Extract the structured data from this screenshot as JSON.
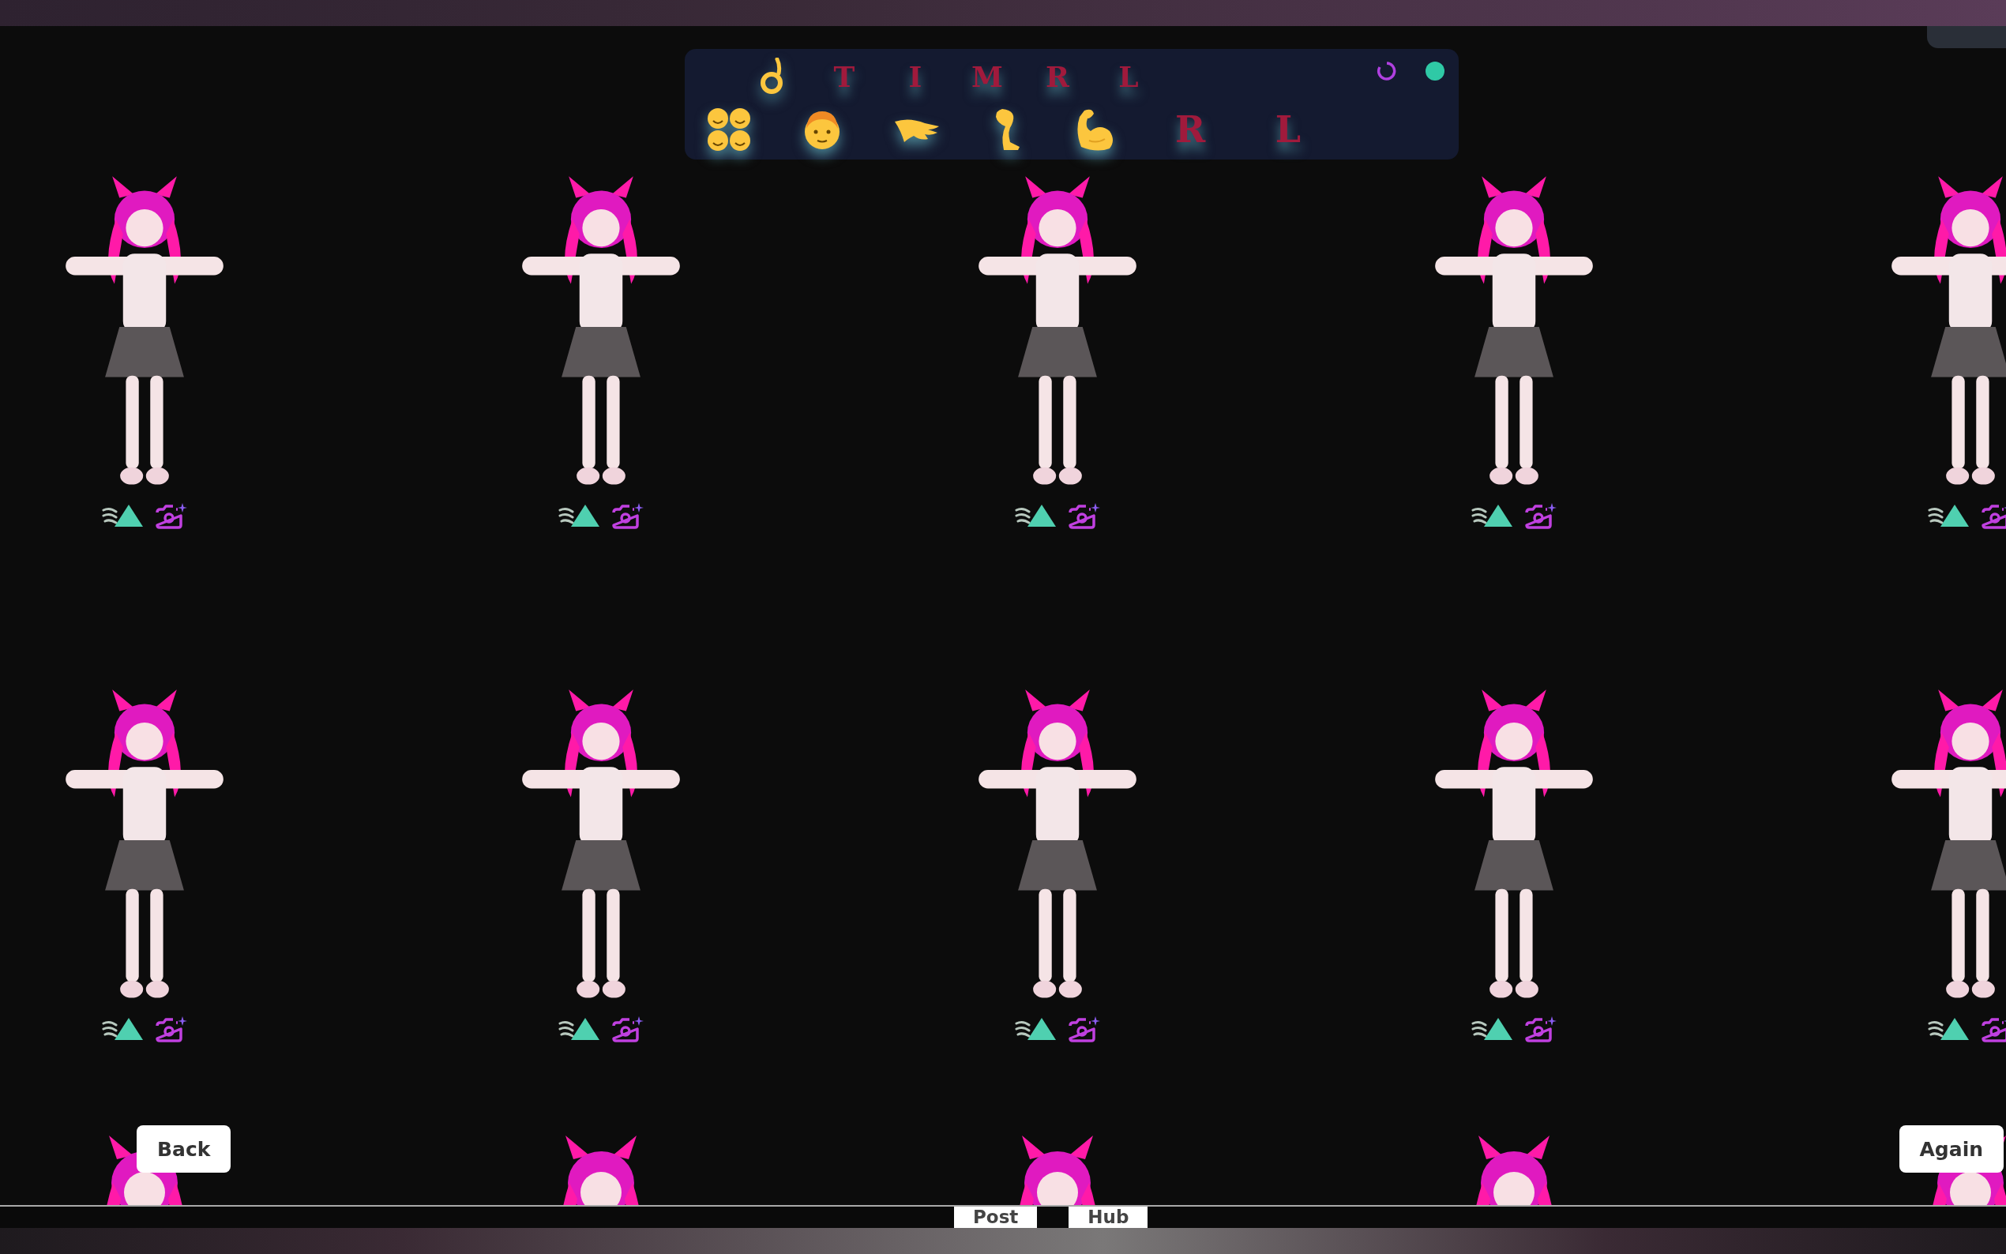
{
  "toolbar": {
    "top_letters": [
      "T",
      "I",
      "M",
      "R",
      "L"
    ],
    "bottom_letters": [
      "R",
      "L"
    ]
  },
  "buttons": {
    "back": "Back",
    "again": "Again"
  },
  "bottom_tabs": [
    "Post",
    "Hub"
  ]
}
